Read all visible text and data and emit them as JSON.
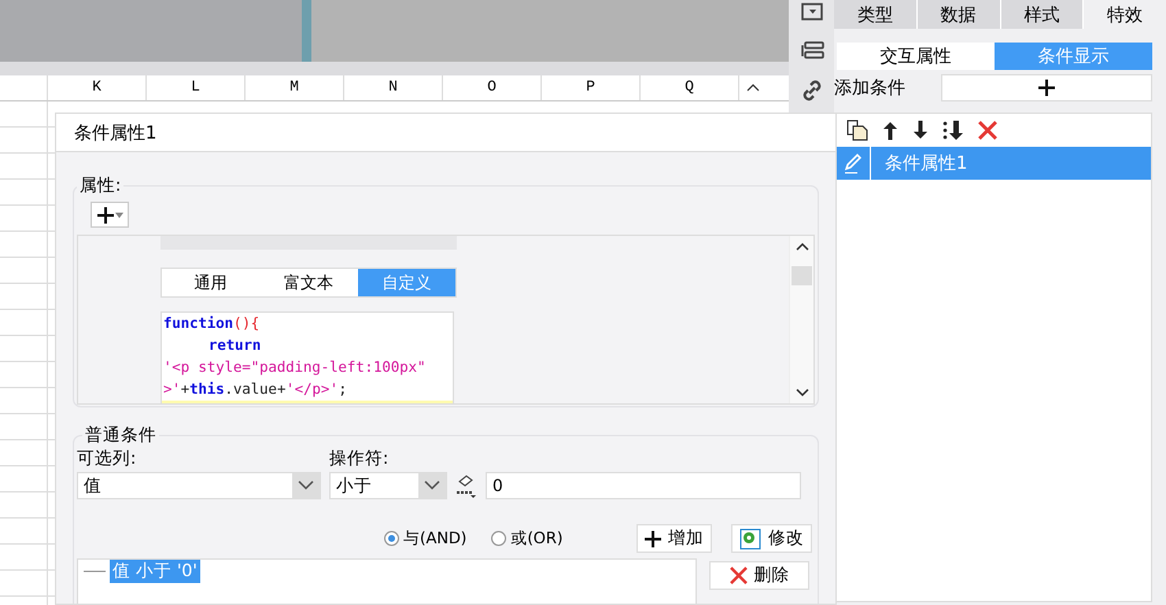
{
  "sheet": {
    "columns": [
      "K",
      "L",
      "M",
      "N",
      "O",
      "P",
      "Q"
    ]
  },
  "dialog": {
    "title": "条件属性1",
    "properties": {
      "legend": "属性:",
      "tabs": [
        {
          "label": "通用",
          "selected": false
        },
        {
          "label": "富文本",
          "selected": false
        },
        {
          "label": "自定义",
          "selected": true
        }
      ],
      "code": [
        {
          "indent": false,
          "tokens": [
            {
              "kind": "keyword",
              "text": "function"
            },
            {
              "kind": "punct",
              "text": "(){"
            }
          ]
        },
        {
          "indent": true,
          "tokens": [
            {
              "kind": "keyword",
              "text": "return"
            }
          ]
        },
        {
          "indent": false,
          "tokens": [
            {
              "kind": "string",
              "text": "'<p style=\"padding-left:100px\""
            }
          ]
        },
        {
          "indent": false,
          "tokens": [
            {
              "kind": "string",
              "text": ">'"
            },
            {
              "kind": "plain",
              "text": "+"
            },
            {
              "kind": "keyword",
              "text": "this"
            },
            {
              "kind": "plain",
              "text": ".value+"
            },
            {
              "kind": "string",
              "text": "'</p>'"
            },
            {
              "kind": "plain",
              "text": ";"
            }
          ]
        }
      ]
    },
    "condition": {
      "legend": "普通条件",
      "column_label": "可选列:",
      "column_value": "值",
      "operator_label": "操作符:",
      "operator_value": "小于",
      "value": "0",
      "joins": [
        {
          "label": "与(AND)",
          "selected": true
        },
        {
          "label": "或(OR)",
          "selected": false
        }
      ],
      "add_button": "增加",
      "modify_button": "修改",
      "delete_button": "删除",
      "conditions": [
        {
          "text": "值 小于 '0'",
          "selected": true
        }
      ]
    }
  },
  "side": {
    "tabs": [
      {
        "label": "类型",
        "selected": false
      },
      {
        "label": "数据",
        "selected": false
      },
      {
        "label": "样式",
        "selected": false
      },
      {
        "label": "特效",
        "selected": true
      }
    ],
    "modes": [
      {
        "label": "交互属性",
        "selected": false
      },
      {
        "label": "条件显示",
        "selected": true
      }
    ],
    "add_label": "添加条件",
    "items": [
      {
        "label": "条件属性1",
        "selected": true
      }
    ]
  }
}
